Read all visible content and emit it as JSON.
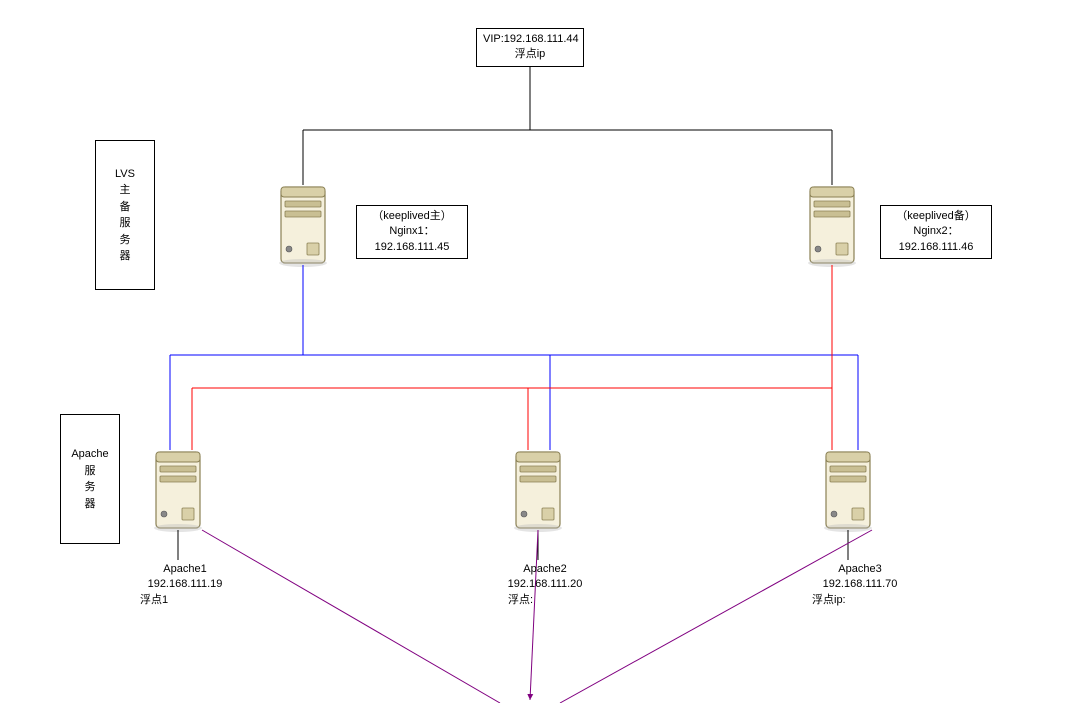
{
  "vip": {
    "line1": "VIP:192.168.111.44",
    "line2": "浮点ip"
  },
  "lvs_box": {
    "l1": "LVS",
    "l2": "主",
    "l3": "备",
    "l4": "服",
    "l5": "务",
    "l6": "器"
  },
  "apache_box": {
    "l1": "Apache",
    "l2": "服",
    "l3": "务",
    "l4": "器"
  },
  "nginx1": {
    "line1": "（keeplived主）",
    "line2": "Nginx1：",
    "line3": "192.168.111.45"
  },
  "nginx2": {
    "line1": "（keeplived备）",
    "line2": "Nginx2：",
    "line3": "192.168.111.46"
  },
  "apache1": {
    "name": "Apache1",
    "ip": "192.168.111.19",
    "float": "浮点1"
  },
  "apache2": {
    "name": "Apache2",
    "ip": "192.168.111.20",
    "float": "浮点:"
  },
  "apache3": {
    "name": "Apache3",
    "ip": "192.168.111.70",
    "float": "浮点ip:"
  },
  "icons": {
    "server": "server-tower-icon"
  },
  "colors": {
    "blue_line": "#0000ff",
    "red_line": "#ff0000",
    "purple_line": "#800080",
    "black_line": "#000000"
  }
}
